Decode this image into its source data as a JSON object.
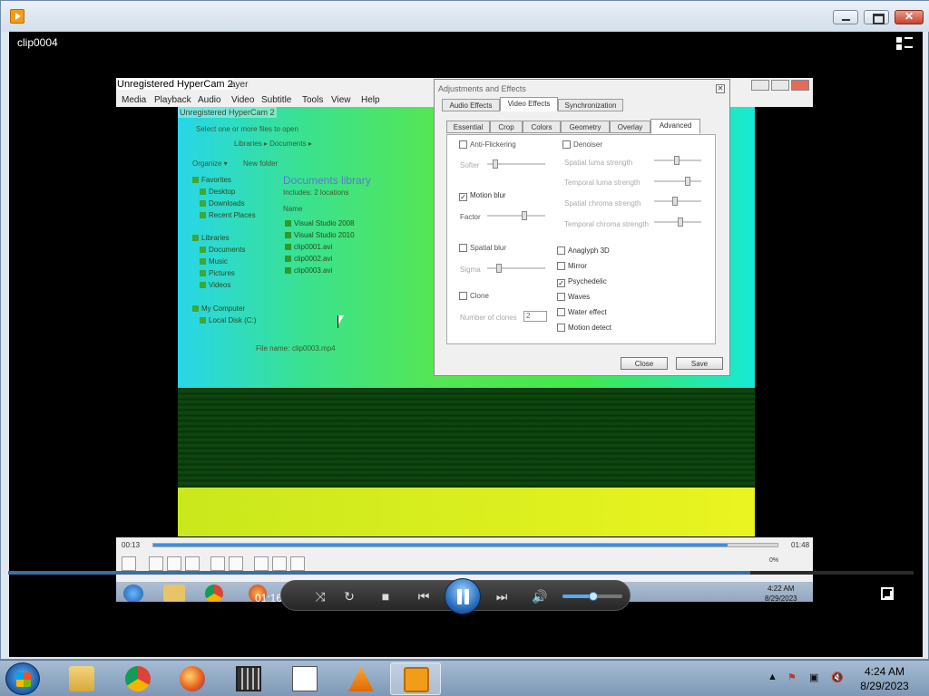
{
  "window": {
    "title": "clip0004",
    "accent": "#3b6ea5"
  },
  "inner": {
    "hypercam_title": "Unregistered HyperCam 2",
    "player_title_fragment": "ayer",
    "menu": [
      "Media",
      "Playback",
      "Audio",
      "Video",
      "Subtitle",
      "Tools",
      "View",
      "Help"
    ],
    "content_title": "Unregistered HyperCam 2",
    "explorer": {
      "header": "Select one or more files to open",
      "breadcrumb": "Libraries ▸ Documents ▸",
      "organize": "Organize ▾",
      "new_folder": "New folder",
      "library_title": "Documents library",
      "includes": "Includes: 2 locations",
      "name_col": "Name",
      "nav": [
        "Favorites",
        "Desktop",
        "Downloads",
        "Recent Places",
        "Libraries",
        "Documents",
        "Music",
        "Pictures",
        "Videos",
        "My Computer",
        "Local Disk (C:)"
      ],
      "files": [
        "Visual Studio 2008",
        "Visual Studio 2010",
        "clip0001.avi",
        "clip0002.avi",
        "clip0003.avi"
      ],
      "filename_label": "File name:",
      "filename_value": "clip0003.mp4"
    },
    "adjustments": {
      "title": "Adjustments and Effects",
      "top_tabs": [
        "Audio Effects",
        "Video Effects",
        "Synchronization"
      ],
      "sub_tabs": [
        "Essential",
        "Crop",
        "Colors",
        "Geometry",
        "Overlay",
        "Advanced"
      ],
      "left": {
        "anti_flicker": "Anti-Flickering",
        "softer": "Softer",
        "motion_blur": "Motion blur",
        "factor": "Factor",
        "spatial_blur": "Spatial blur",
        "sigma": "Sigma",
        "clone": "Clone",
        "number_of_clones": "Number of clones",
        "clones_value": "2"
      },
      "right": {
        "denoiser": "Denoiser",
        "spatial_luma": "Spatial luma strength",
        "temporal_luma": "Temporal luma strength",
        "spatial_chroma": "Spatial chroma strength",
        "temporal_chroma": "Temporal chroma strength",
        "anaglyph": "Anaglyph 3D",
        "mirror": "Mirror",
        "psychedelic": "Psychedelic",
        "waves": "Waves",
        "water_effect": "Water effect",
        "motion_detect": "Motion detect"
      },
      "checked": {
        "motion_blur": true,
        "psychedelic": true
      },
      "close_button": "Close",
      "save_button": "Save"
    },
    "player": {
      "time_elapsed": "00:13",
      "time_total": "01:48",
      "progress": 0.92,
      "volume_label": "0%"
    },
    "taskbar": {
      "time": "4:22 AM",
      "date": "8/29/2023"
    }
  },
  "controls": {
    "elapsed": "01:16",
    "progress": 0.82,
    "volume": 0.52
  },
  "taskbar": {
    "time": "4:24 AM",
    "date": "8/29/2023",
    "items": [
      "start-orb",
      "windows-explorer",
      "google-chrome",
      "firefox",
      "movie-maker",
      "notepad",
      "vlc",
      "vlc-player-active"
    ]
  }
}
